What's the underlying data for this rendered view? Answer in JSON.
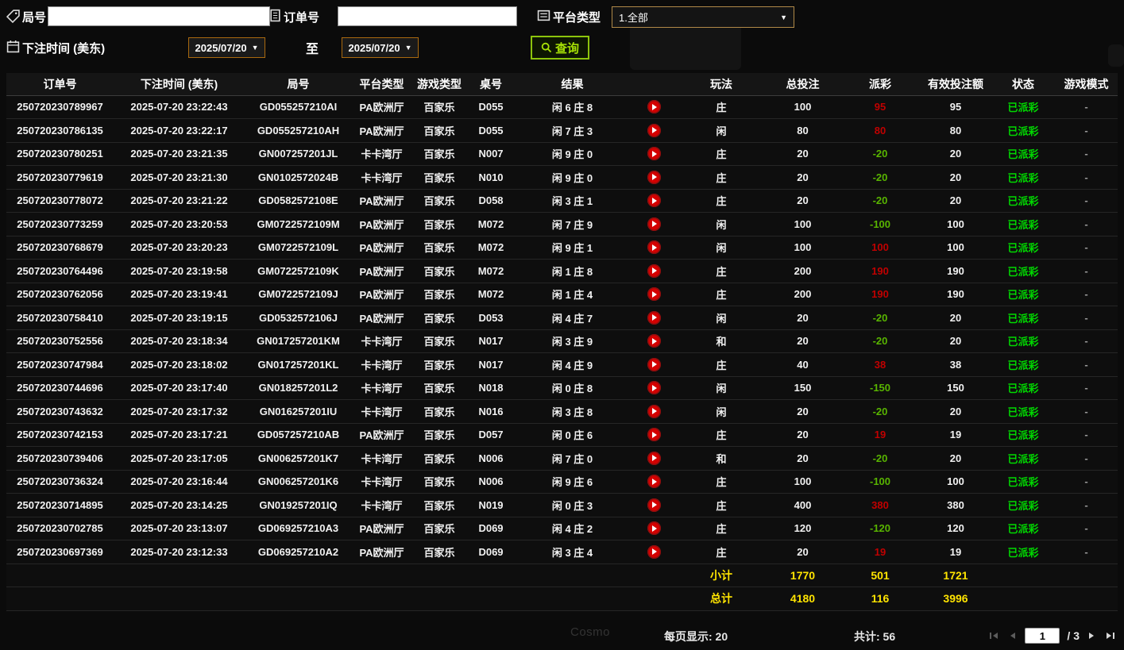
{
  "colors": {
    "background": "#0b0b0b",
    "payout_win_red": "#c00000",
    "payout_loss_green": "#58b400",
    "status_paid_green": "#00d800",
    "totals_yellow": "#ffe400",
    "query_button_green": "#a8e206",
    "date_border_orange": "#a9690f",
    "dropdown_border_tan": "#b08948",
    "play_button_red": "#d40000"
  },
  "icons": {
    "game_no": "tag-icon",
    "order_no": "document-icon",
    "platform_type": "list-icon",
    "bet_time": "calendar-icon",
    "query": "magnifier-icon",
    "replay": "play-icon",
    "pagination_first": "first-page-icon",
    "pagination_prev": "prev-page-icon",
    "pagination_next": "next-page-icon",
    "pagination_last": "last-page-icon"
  },
  "filters": {
    "game_no_label": "局号",
    "game_no_value": "",
    "order_no_label": "订单号",
    "order_no_value": "",
    "platform_type_label": "平台类型",
    "platform_type_value": "1.全部",
    "bet_time_label": "下注时间 (美东)",
    "date_from": "2025/07/20",
    "to_label": "至",
    "date_to": "2025/07/20",
    "query_label": "查询"
  },
  "table": {
    "headers": [
      "订单号",
      "下注时间 (美东)",
      "局号",
      "平台类型",
      "游戏类型",
      "桌号",
      "结果",
      "",
      "玩法",
      "总投注",
      "派彩",
      "有效投注额",
      "状态",
      "游戏模式"
    ],
    "rows": [
      {
        "order_no": "250720230789967",
        "bet_time": "2025-07-20 23:22:43",
        "game_no": "GD055257210AI",
        "platform": "PA欧洲厅",
        "game_type": "百家乐",
        "table_no": "D055",
        "result": "闲 6 庄 8",
        "bet_type": "庄",
        "total_bet": "100",
        "payout": "95",
        "payout_sign": "win",
        "valid_bet": "95",
        "status": "已派彩",
        "mode": "-"
      },
      {
        "order_no": "250720230786135",
        "bet_time": "2025-07-20 23:22:17",
        "game_no": "GD055257210AH",
        "platform": "PA欧洲厅",
        "game_type": "百家乐",
        "table_no": "D055",
        "result": "闲 7 庄 3",
        "bet_type": "闲",
        "total_bet": "80",
        "payout": "80",
        "payout_sign": "win",
        "valid_bet": "80",
        "status": "已派彩",
        "mode": "-"
      },
      {
        "order_no": "250720230780251",
        "bet_time": "2025-07-20 23:21:35",
        "game_no": "GN007257201JL",
        "platform": "卡卡湾厅",
        "game_type": "百家乐",
        "table_no": "N007",
        "result": "闲 9 庄 0",
        "bet_type": "庄",
        "total_bet": "20",
        "payout": "-20",
        "payout_sign": "loss",
        "valid_bet": "20",
        "status": "已派彩",
        "mode": "-"
      },
      {
        "order_no": "250720230779619",
        "bet_time": "2025-07-20 23:21:30",
        "game_no": "GN0102572024B",
        "platform": "卡卡湾厅",
        "game_type": "百家乐",
        "table_no": "N010",
        "result": "闲 9 庄 0",
        "bet_type": "庄",
        "total_bet": "20",
        "payout": "-20",
        "payout_sign": "loss",
        "valid_bet": "20",
        "status": "已派彩",
        "mode": "-"
      },
      {
        "order_no": "250720230778072",
        "bet_time": "2025-07-20 23:21:22",
        "game_no": "GD0582572108E",
        "platform": "PA欧洲厅",
        "game_type": "百家乐",
        "table_no": "D058",
        "result": "闲 3 庄 1",
        "bet_type": "庄",
        "total_bet": "20",
        "payout": "-20",
        "payout_sign": "loss",
        "valid_bet": "20",
        "status": "已派彩",
        "mode": "-"
      },
      {
        "order_no": "250720230773259",
        "bet_time": "2025-07-20 23:20:53",
        "game_no": "GM0722572109M",
        "platform": "PA欧洲厅",
        "game_type": "百家乐",
        "table_no": "M072",
        "result": "闲 7 庄 9",
        "bet_type": "闲",
        "total_bet": "100",
        "payout": "-100",
        "payout_sign": "loss",
        "valid_bet": "100",
        "status": "已派彩",
        "mode": "-"
      },
      {
        "order_no": "250720230768679",
        "bet_time": "2025-07-20 23:20:23",
        "game_no": "GM0722572109L",
        "platform": "PA欧洲厅",
        "game_type": "百家乐",
        "table_no": "M072",
        "result": "闲 9 庄 1",
        "bet_type": "闲",
        "total_bet": "100",
        "payout": "100",
        "payout_sign": "win",
        "valid_bet": "100",
        "status": "已派彩",
        "mode": "-"
      },
      {
        "order_no": "250720230764496",
        "bet_time": "2025-07-20 23:19:58",
        "game_no": "GM0722572109K",
        "platform": "PA欧洲厅",
        "game_type": "百家乐",
        "table_no": "M072",
        "result": "闲 1 庄 8",
        "bet_type": "庄",
        "total_bet": "200",
        "payout": "190",
        "payout_sign": "win",
        "valid_bet": "190",
        "status": "已派彩",
        "mode": "-"
      },
      {
        "order_no": "250720230762056",
        "bet_time": "2025-07-20 23:19:41",
        "game_no": "GM0722572109J",
        "platform": "PA欧洲厅",
        "game_type": "百家乐",
        "table_no": "M072",
        "result": "闲 1 庄 4",
        "bet_type": "庄",
        "total_bet": "200",
        "payout": "190",
        "payout_sign": "win",
        "valid_bet": "190",
        "status": "已派彩",
        "mode": "-"
      },
      {
        "order_no": "250720230758410",
        "bet_time": "2025-07-20 23:19:15",
        "game_no": "GD0532572106J",
        "platform": "PA欧洲厅",
        "game_type": "百家乐",
        "table_no": "D053",
        "result": "闲 4 庄 7",
        "bet_type": "闲",
        "total_bet": "20",
        "payout": "-20",
        "payout_sign": "loss",
        "valid_bet": "20",
        "status": "已派彩",
        "mode": "-"
      },
      {
        "order_no": "250720230752556",
        "bet_time": "2025-07-20 23:18:34",
        "game_no": "GN017257201KM",
        "platform": "卡卡湾厅",
        "game_type": "百家乐",
        "table_no": "N017",
        "result": "闲 3 庄 9",
        "bet_type": "和",
        "total_bet": "20",
        "payout": "-20",
        "payout_sign": "loss",
        "valid_bet": "20",
        "status": "已派彩",
        "mode": "-"
      },
      {
        "order_no": "250720230747984",
        "bet_time": "2025-07-20 23:18:02",
        "game_no": "GN017257201KL",
        "platform": "卡卡湾厅",
        "game_type": "百家乐",
        "table_no": "N017",
        "result": "闲 4 庄 9",
        "bet_type": "庄",
        "total_bet": "40",
        "payout": "38",
        "payout_sign": "win",
        "valid_bet": "38",
        "status": "已派彩",
        "mode": "-"
      },
      {
        "order_no": "250720230744696",
        "bet_time": "2025-07-20 23:17:40",
        "game_no": "GN018257201L2",
        "platform": "卡卡湾厅",
        "game_type": "百家乐",
        "table_no": "N018",
        "result": "闲 0 庄 8",
        "bet_type": "闲",
        "total_bet": "150",
        "payout": "-150",
        "payout_sign": "loss",
        "valid_bet": "150",
        "status": "已派彩",
        "mode": "-"
      },
      {
        "order_no": "250720230743632",
        "bet_time": "2025-07-20 23:17:32",
        "game_no": "GN016257201IU",
        "platform": "卡卡湾厅",
        "game_type": "百家乐",
        "table_no": "N016",
        "result": "闲 3 庄 8",
        "bet_type": "闲",
        "total_bet": "20",
        "payout": "-20",
        "payout_sign": "loss",
        "valid_bet": "20",
        "status": "已派彩",
        "mode": "-"
      },
      {
        "order_no": "250720230742153",
        "bet_time": "2025-07-20 23:17:21",
        "game_no": "GD057257210AB",
        "platform": "PA欧洲厅",
        "game_type": "百家乐",
        "table_no": "D057",
        "result": "闲 0 庄 6",
        "bet_type": "庄",
        "total_bet": "20",
        "payout": "19",
        "payout_sign": "win",
        "valid_bet": "19",
        "status": "已派彩",
        "mode": "-"
      },
      {
        "order_no": "250720230739406",
        "bet_time": "2025-07-20 23:17:05",
        "game_no": "GN006257201K7",
        "platform": "卡卡湾厅",
        "game_type": "百家乐",
        "table_no": "N006",
        "result": "闲 7 庄 0",
        "bet_type": "和",
        "total_bet": "20",
        "payout": "-20",
        "payout_sign": "loss",
        "valid_bet": "20",
        "status": "已派彩",
        "mode": "-"
      },
      {
        "order_no": "250720230736324",
        "bet_time": "2025-07-20 23:16:44",
        "game_no": "GN006257201K6",
        "platform": "卡卡湾厅",
        "game_type": "百家乐",
        "table_no": "N006",
        "result": "闲 9 庄 6",
        "bet_type": "庄",
        "total_bet": "100",
        "payout": "-100",
        "payout_sign": "loss",
        "valid_bet": "100",
        "status": "已派彩",
        "mode": "-"
      },
      {
        "order_no": "250720230714895",
        "bet_time": "2025-07-20 23:14:25",
        "game_no": "GN019257201IQ",
        "platform": "卡卡湾厅",
        "game_type": "百家乐",
        "table_no": "N019",
        "result": "闲 0 庄 3",
        "bet_type": "庄",
        "total_bet": "400",
        "payout": "380",
        "payout_sign": "win",
        "valid_bet": "380",
        "status": "已派彩",
        "mode": "-"
      },
      {
        "order_no": "250720230702785",
        "bet_time": "2025-07-20 23:13:07",
        "game_no": "GD069257210A3",
        "platform": "PA欧洲厅",
        "game_type": "百家乐",
        "table_no": "D069",
        "result": "闲 4 庄 2",
        "bet_type": "庄",
        "total_bet": "120",
        "payout": "-120",
        "payout_sign": "loss",
        "valid_bet": "120",
        "status": "已派彩",
        "mode": "-"
      },
      {
        "order_no": "250720230697369",
        "bet_time": "2025-07-20 23:12:33",
        "game_no": "GD069257210A2",
        "platform": "PA欧洲厅",
        "game_type": "百家乐",
        "table_no": "D069",
        "result": "闲 3 庄 4",
        "bet_type": "庄",
        "total_bet": "20",
        "payout": "19",
        "payout_sign": "win",
        "valid_bet": "19",
        "status": "已派彩",
        "mode": "-"
      }
    ],
    "subtotal": {
      "label": "小计",
      "total_bet": "1770",
      "payout": "501",
      "valid_bet": "1721"
    },
    "grand_total": {
      "label": "总计",
      "total_bet": "4180",
      "payout": "116",
      "valid_bet": "3996"
    }
  },
  "footer": {
    "per_page": "每页显示: 20",
    "total_count": "共计: 56",
    "page": "1",
    "page_suffix": "/ 3"
  },
  "background_watermark": "Cosmo"
}
